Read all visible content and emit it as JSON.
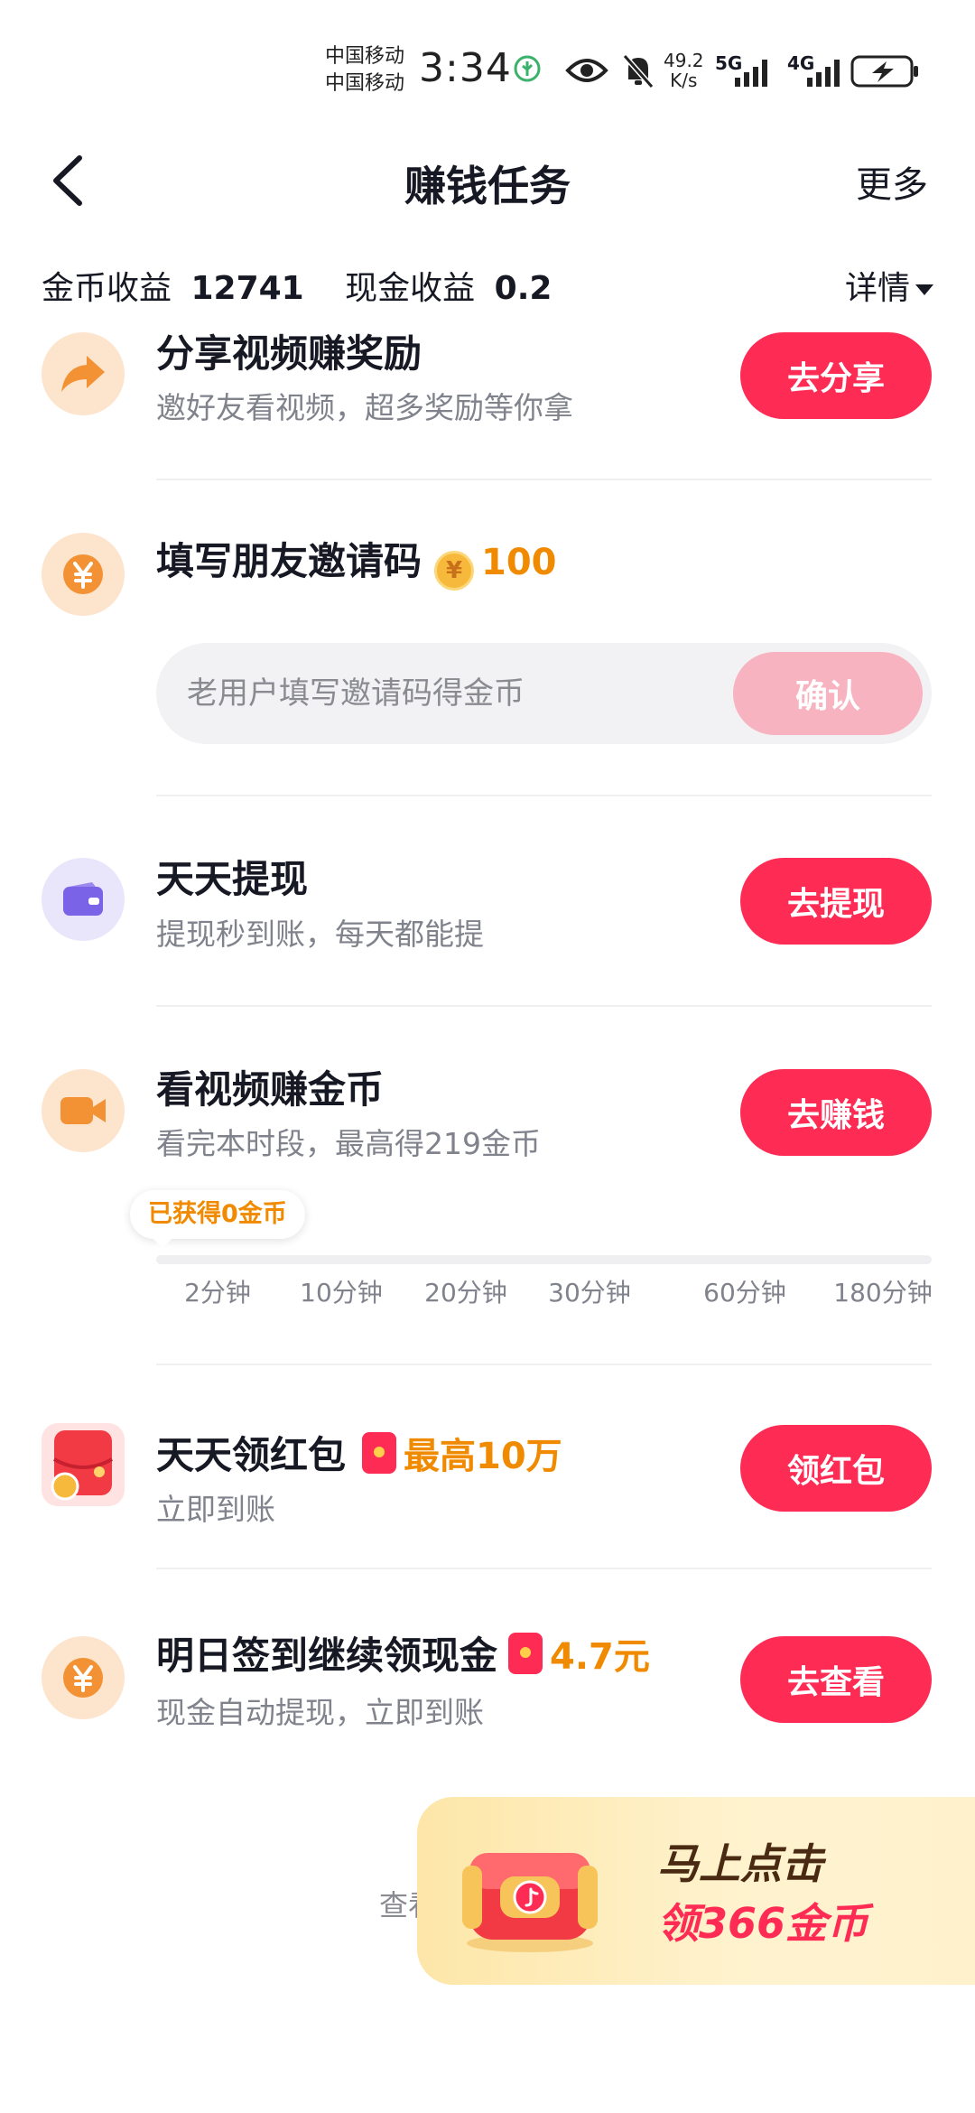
{
  "status_bar": {
    "carrier_1": "中国移动",
    "carrier_2": "中国移动",
    "time": "3:34",
    "speed_value": "49.2",
    "speed_unit": "K/s",
    "signal_1": "5G",
    "signal_2": "4G"
  },
  "header": {
    "title": "赚钱任务",
    "more": "更多"
  },
  "earnings": {
    "coin_label": "金币收益",
    "coin_value": "12741",
    "cash_label": "现金收益",
    "cash_value": "0.2",
    "details": "详情"
  },
  "tasks": {
    "share": {
      "title": "分享视频赚奖励",
      "subtitle": "邀好友看视频，超多奖励等你拿",
      "button": "去分享",
      "icon": "share-arrow-icon"
    },
    "invite": {
      "title": "填写朋友邀请码",
      "reward": "100",
      "placeholder": "老用户填写邀请码得金币",
      "button": "确认",
      "icon": "yuan-coin-icon"
    },
    "withdraw": {
      "title": "天天提现",
      "subtitle": "提现秒到账，每天都能提",
      "button": "去提现",
      "icon": "wallet-icon"
    },
    "watch": {
      "title": "看视频赚金币",
      "subtitle": "看完本时段，最高得219金币",
      "button": "去赚钱",
      "earned_tag": "已获得0金币",
      "progress": 0,
      "ticks": [
        "2分钟",
        "10分钟",
        "20分钟",
        "30分钟",
        "60分钟",
        "180分钟"
      ],
      "icon": "video-camera-icon"
    },
    "redpacket": {
      "title": "天天领红包",
      "reward": "最高10万",
      "subtitle": "立即到账",
      "button": "领红包",
      "icon": "red-packet-icon"
    },
    "checkin": {
      "title": "明日签到继续领现金",
      "reward": "4.7元",
      "subtitle": "现金自动提现，立即到账",
      "button": "去查看",
      "icon": "yuan-coin-icon"
    }
  },
  "footer": {
    "link_partial": "查看"
  },
  "promo": {
    "line1": "马上点击",
    "line2": "领366金币"
  },
  "colors": {
    "accent": "#fe2c55",
    "reward": "#f08a00",
    "icon_bg_orange": "#fde4cc",
    "icon_bg_purple": "#e9e6fb"
  }
}
